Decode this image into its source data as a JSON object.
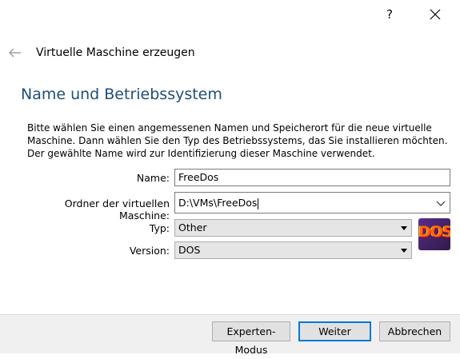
{
  "window": {
    "help_label": "?",
    "title": "Virtuelle Maschine erzeugen"
  },
  "page": {
    "heading": "Name und Betriebssystem",
    "description": "Bitte wählen Sie einen angemessenen Namen und Speicherort für die neue virtuelle Maschine. Dann wählen Sie den Typ des Betriebssystems, das Sie installieren möchten. Der gewählte Name wird zur Identifizierung dieser Maschine verwendet."
  },
  "form": {
    "name_label": "Name:",
    "name_value": "FreeDos",
    "folder_label": "Ordner der virtuellen Maschine:",
    "folder_value": "D:\\VMs\\FreeDos",
    "type_label": "Typ:",
    "type_value": "Other",
    "version_label": "Version:",
    "version_value": "DOS"
  },
  "os_icon": {
    "text": "DOS",
    "icon": "dos-os-icon"
  },
  "buttons": {
    "expert": "Experten-Modus",
    "next": "Weiter",
    "cancel": "Abbrechen"
  },
  "colors": {
    "heading": "#1f4e79",
    "default_button_border": "#0078d7",
    "footer_bg": "#f0f0f0"
  }
}
